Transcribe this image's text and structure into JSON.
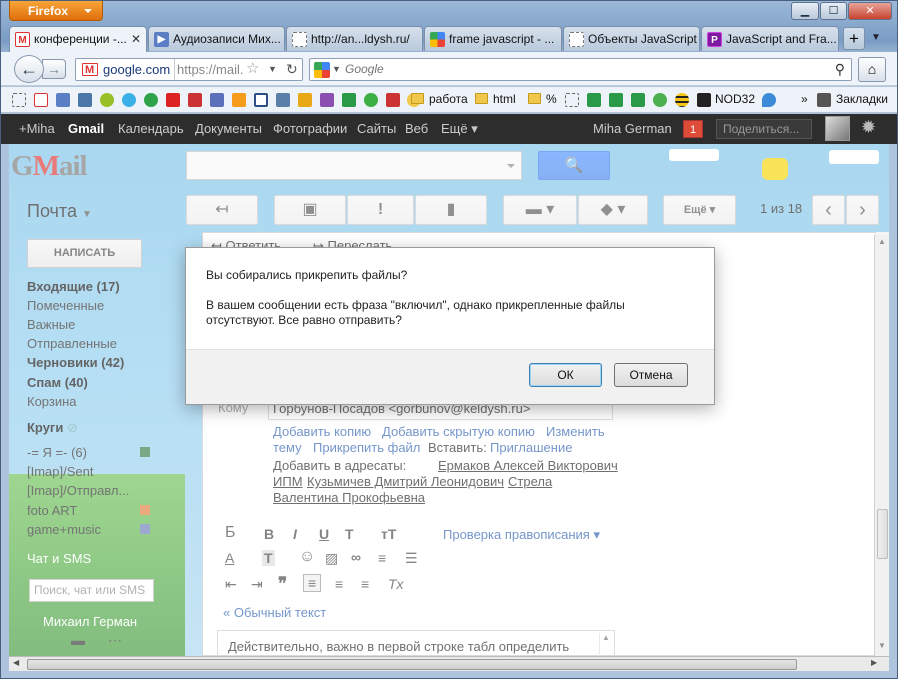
{
  "window": {
    "firefox_button": "Firefox",
    "minimize": "▁",
    "maximize": "☐",
    "close": "✕"
  },
  "tabs": [
    {
      "label": "конференции -...",
      "fav_letter": "M",
      "fav_color": "#ffffff"
    },
    {
      "label": "Аудиозаписи Мих...",
      "fav_letter": "▶",
      "fav_color": "#5b7fc4"
    },
    {
      "label": "http://an...ldysh.ru/",
      "fav_letter": "",
      "fav_color": "#ffffff"
    },
    {
      "label": "frame javascript - ...",
      "fav_letter": "",
      "fav_color": "#4285f4"
    },
    {
      "label": "Объекты JavaScript",
      "fav_letter": "",
      "fav_color": "#ffffff"
    },
    {
      "label": "JavaScript and Fra...",
      "fav_letter": "P",
      "fav_color": "#7e1aa0"
    }
  ],
  "newtab": "+",
  "tablist": "▼",
  "nav": {
    "back": "←",
    "forward": "→",
    "url_domain": "google.com",
    "url_path": "https://mail.",
    "star": "☆",
    "reload": "↻",
    "search_placeholder": "Google",
    "search_icon": "⚲",
    "home": "⌂"
  },
  "bookmarks": {
    "folders": [
      "работа",
      "html",
      "%"
    ],
    "nod": "NOD32",
    "more": "»",
    "bookmarks_label": "Закладки"
  },
  "gbar": {
    "items": [
      "+Miha",
      "Gmail",
      "Календарь",
      "Документы",
      "Фотографии",
      "Сайты",
      "Веб",
      "Ещё ▾"
    ],
    "user": "Miha German",
    "notifications": "1",
    "share_placeholder": "Поделиться..."
  },
  "gmail": {
    "logo_g": "G",
    "logo_m": "M",
    "logo_rest": "ail",
    "search_button": "🔍",
    "folder_title": "Почта",
    "toolbar": {
      "reply": "↤",
      "archive": "▣",
      "spam": "!",
      "delete": "▮",
      "folder": "▬ ▾",
      "label": "◆ ▾",
      "more": "Ещё ▾"
    },
    "counter_range": "1 из 18",
    "prev": "‹",
    "next": "›",
    "compose": "НАПИСАТЬ",
    "nav": [
      {
        "label": "Входящие (17)",
        "bold": true
      },
      {
        "label": "Помеченные",
        "bold": false
      },
      {
        "label": "Важные",
        "bold": false
      },
      {
        "label": "Отправленные",
        "bold": false
      },
      {
        "label": "Черновики (42)",
        "bold": true
      },
      {
        "label": "Спам (40)",
        "bold": true
      },
      {
        "label": "Корзина",
        "bold": false
      }
    ],
    "circles": "Круги",
    "labels": [
      {
        "label": "-= Я =- (6)",
        "color": "#2f7b45"
      },
      {
        "label": "[Imap]/Sent",
        "color": ""
      },
      {
        "label": "[Imap]/Отправл...",
        "color": ""
      },
      {
        "label": "foto ART",
        "color": "#e07b39"
      },
      {
        "label": "game+music",
        "color": "#6c7ab5"
      }
    ],
    "chat_title": "Чат и SMS",
    "chat_search": "Поиск, чат или SMS",
    "chat_user": "Михаил Герман"
  },
  "message": {
    "reply_tab": "Ответить",
    "forward_tab": "Переслать",
    "to_label": "Кому",
    "to_value": "Горбунов-Посадов <gorbunov@keldysh.ru>",
    "add_cc": "Добавить копию",
    "add_bcc": "Добавить скрытую копию",
    "change_line1": "Изменить",
    "change_line2": "тему",
    "attach": "Прикрепить файл",
    "insert_label": "Вставить:",
    "invite": "Приглашение",
    "add_recipients": "Добавить в адресаты:",
    "r1": "Ермаков Алексей Викторович",
    "r2": "ИПМ",
    "r3": "Кузьмичев Дмитрий Леонидович",
    "r4": "Стрела",
    "r5": "Валентина Прокофьевна",
    "fmt_row1": [
      "Б",
      "B",
      "I",
      "U",
      "T",
      "тT"
    ],
    "spell": "Проверка правописания ▾",
    "fmt_row2": [
      "A",
      "T",
      "☺",
      "▨",
      "∞",
      "≡",
      "☰"
    ],
    "fmt_row3": [
      "⇤",
      "⇥",
      "❞",
      "≡",
      "≡",
      "≡",
      "Tx"
    ],
    "plain_text": "« Обычный текст",
    "body_text": "Действительно, важно в первой строке табл определить"
  },
  "dialog": {
    "title": "Вы собирались прикрепить файлы?",
    "text": "В вашем сообщении есть фраза \"включил\", однако прикрепленные файлы отсутствуют. Все равно отправить?",
    "ok": "ОК",
    "cancel": "Отмена"
  }
}
